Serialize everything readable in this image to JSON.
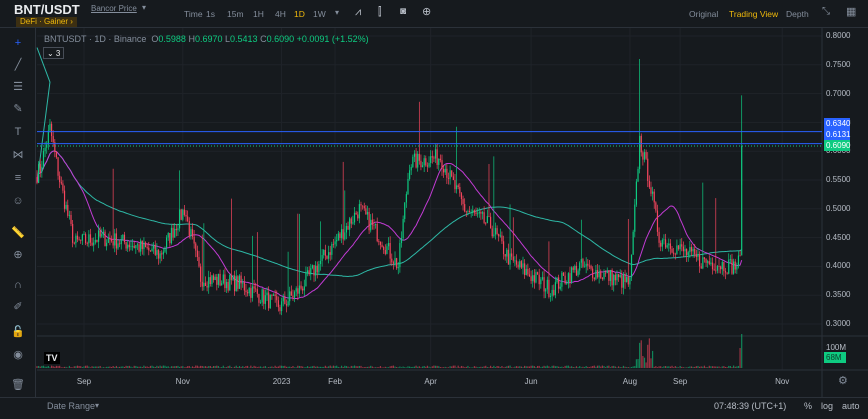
{
  "header": {
    "symbol": "BNT/USDT",
    "price_link": "Bancor Price",
    "tags": "DeFi · Gainer ›",
    "timeframes": [
      "Time",
      "1s",
      "15m",
      "1H",
      "4H",
      "1D",
      "1W"
    ],
    "active_timeframe": "1D",
    "views": [
      "Original",
      "Trading View",
      "Depth"
    ],
    "active_view": "Trading View"
  },
  "legend": {
    "title": "BNTUSDT · 1D · Binance",
    "o_label": "O",
    "o": "0.5988",
    "h_label": "H",
    "h": "0.6970",
    "l_label": "L",
    "l": "0.5413",
    "c_label": "C",
    "c": "0.6090",
    "change": "+0.0091 (+1.52%)",
    "indicators": "⌄ 3"
  },
  "price_labels": {
    "line1": "0.6340",
    "line2": "0.6131",
    "last": "0.6090",
    "volume_scale": "100M",
    "volume_last": "68M"
  },
  "colors": {
    "up": "#0ecb81",
    "down": "#f6465d",
    "accent": "#f0b90b",
    "line": "#2962ff",
    "ma_fast": "#c23bd4",
    "ma_slow": "#2eb8a6"
  },
  "footer": {
    "date_range": "Date Range",
    "time": "07:48:39 (UTC+1)",
    "percent": "%",
    "log": "log",
    "auto": "auto"
  },
  "chart_data": {
    "type": "candlestick",
    "symbol": "BNTUSDT",
    "interval": "1D",
    "y_ticks": [
      "0.8000",
      "0.7500",
      "0.7000",
      "0.6500",
      "0.6000",
      "0.5500",
      "0.5000",
      "0.4500",
      "0.4000",
      "0.3500",
      "0.3000"
    ],
    "ylim": [
      0.3,
      0.8
    ],
    "x_ticks": [
      {
        "label": "Sep",
        "day": 29
      },
      {
        "label": "Nov",
        "day": 90
      },
      {
        "label": "2023",
        "day": 151
      },
      {
        "label": "Feb",
        "day": 184
      },
      {
        "label": "Apr",
        "day": 243
      },
      {
        "label": "Jun",
        "day": 305
      },
      {
        "label": "Aug",
        "day": 366
      },
      {
        "label": "Sep",
        "day": 397
      },
      {
        "label": "Nov",
        "day": 460
      }
    ],
    "close_keypoints": [
      [
        0,
        0.56
      ],
      [
        2,
        0.57
      ],
      [
        8,
        0.64
      ],
      [
        14,
        0.55
      ],
      [
        23,
        0.44
      ],
      [
        39,
        0.45
      ],
      [
        57,
        0.44
      ],
      [
        76,
        0.42
      ],
      [
        91,
        0.5
      ],
      [
        101,
        0.38
      ],
      [
        125,
        0.37
      ],
      [
        150,
        0.33
      ],
      [
        162,
        0.36
      ],
      [
        181,
        0.43
      ],
      [
        199,
        0.5
      ],
      [
        212,
        0.45
      ],
      [
        223,
        0.4
      ],
      [
        230,
        0.58
      ],
      [
        249,
        0.59
      ],
      [
        264,
        0.5
      ],
      [
        280,
        0.47
      ],
      [
        292,
        0.41
      ],
      [
        317,
        0.36
      ],
      [
        335,
        0.4
      ],
      [
        366,
        0.37
      ],
      [
        372,
        0.62
      ],
      [
        378,
        0.55
      ],
      [
        384,
        0.45
      ],
      [
        409,
        0.41
      ],
      [
        431,
        0.4
      ],
      [
        434,
        0.41
      ],
      [
        435,
        0.609
      ]
    ],
    "horizontal_lines": [
      0.634,
      0.6131
    ],
    "last_price": 0.609
  }
}
